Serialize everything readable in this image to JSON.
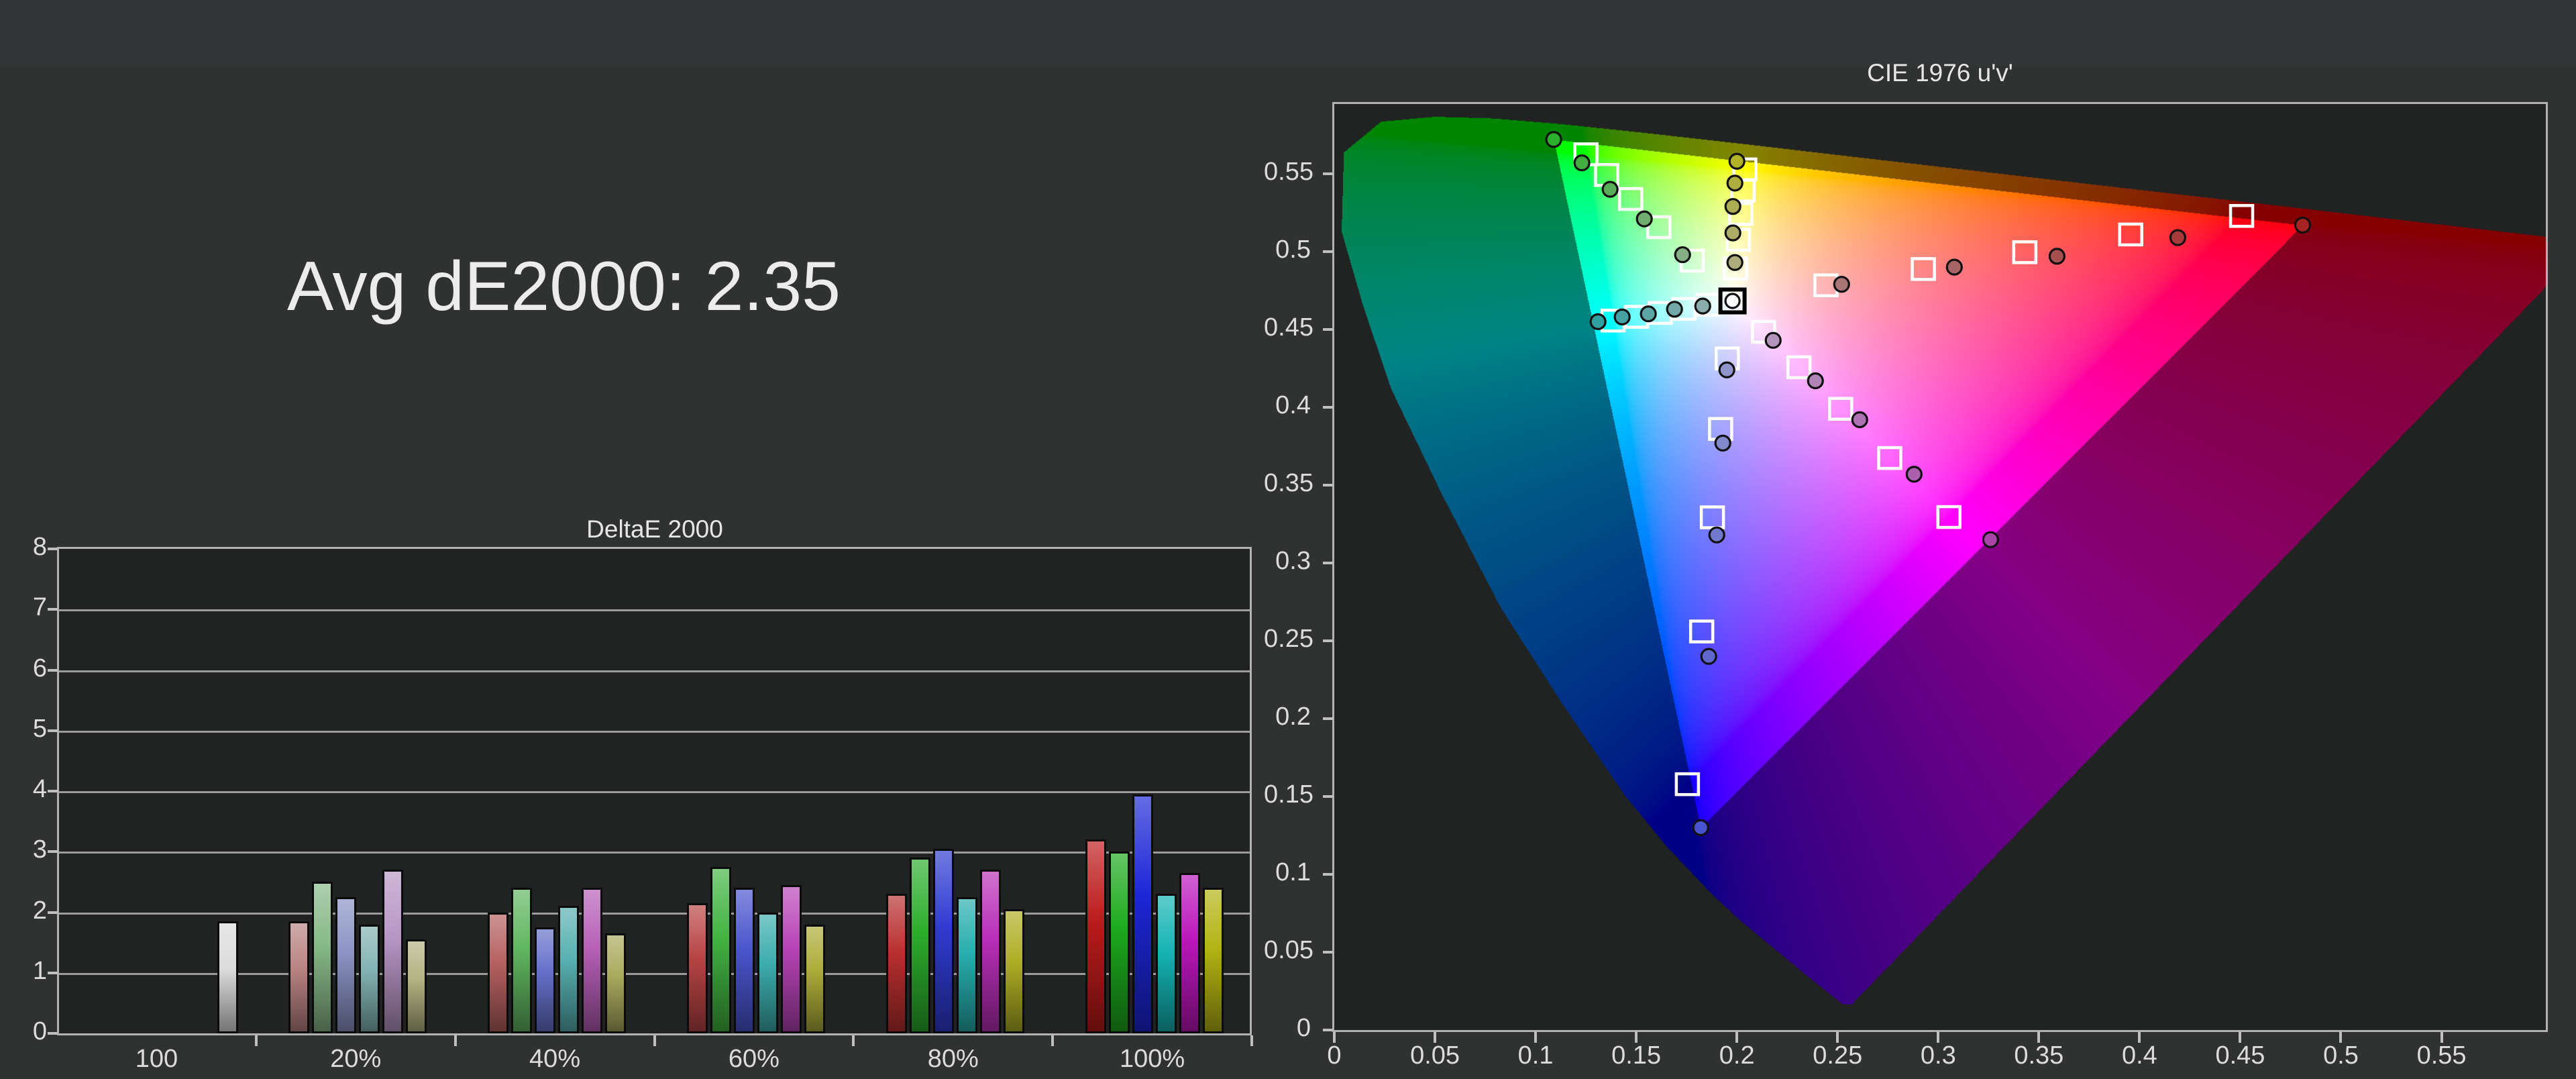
{
  "summary": {
    "text": "Avg dE2000: 2.35"
  },
  "colors": {
    "page_bg": "#303131",
    "plot_bg": "#212222",
    "grid": "#9b9b9b",
    "border": "#b2b2b2",
    "tick_text": "#dcdcdc",
    "title_text": "#e6e6e6",
    "bar_outline": "#0b0b0b",
    "target_square_stroke": "#ffffff",
    "white_square_stroke": "#000000",
    "measured_circle_stroke": "#111111",
    "outside_gamut_dim": 0.52
  },
  "chart_data": [
    {
      "type": "bar",
      "title": "DeltaE 2000",
      "ylabel": "",
      "xlabel": "",
      "ylim": [
        0,
        8
      ],
      "yticks": [
        "0",
        "1",
        "2",
        "3",
        "4",
        "5",
        "6",
        "7",
        "8"
      ],
      "grid": true,
      "categories": [
        "100",
        "20%",
        "40%",
        "60%",
        "80%",
        "100%"
      ],
      "groups": [
        {
          "label": "100",
          "bars": [
            {
              "series": "white",
              "value": 1.85,
              "color": "#dcdcdc"
            }
          ]
        },
        {
          "label": "20%",
          "bars": [
            {
              "series": "red",
              "value": 1.85,
              "color": "#b98383"
            },
            {
              "series": "green",
              "value": 2.5,
              "color": "#87b987"
            },
            {
              "series": "blue",
              "value": 2.25,
              "color": "#8a92c3"
            },
            {
              "series": "cyan",
              "value": 1.8,
              "color": "#83b3b3"
            },
            {
              "series": "magenta",
              "value": 2.7,
              "color": "#b795c4"
            },
            {
              "series": "yellow",
              "value": 1.55,
              "color": "#b3b383"
            }
          ]
        },
        {
          "label": "40%",
          "bars": [
            {
              "series": "red",
              "value": 2.0,
              "color": "#b66060"
            },
            {
              "series": "green",
              "value": 2.4,
              "color": "#60b660"
            },
            {
              "series": "blue",
              "value": 1.75,
              "color": "#6570c9"
            },
            {
              "series": "cyan",
              "value": 2.1,
              "color": "#57b0b0"
            },
            {
              "series": "magenta",
              "value": 2.4,
              "color": "#b65fb6"
            },
            {
              "series": "yellow",
              "value": 1.65,
              "color": "#aaaa5e"
            }
          ]
        },
        {
          "label": "60%",
          "bars": [
            {
              "series": "red",
              "value": 2.15,
              "color": "#b84444"
            },
            {
              "series": "green",
              "value": 2.75,
              "color": "#41b441"
            },
            {
              "series": "blue",
              "value": 2.4,
              "color": "#4a55cd"
            },
            {
              "series": "cyan",
              "value": 2.0,
              "color": "#3cadad"
            },
            {
              "series": "magenta",
              "value": 2.45,
              "color": "#b844b8"
            },
            {
              "series": "yellow",
              "value": 1.8,
              "color": "#acac38"
            }
          ]
        },
        {
          "label": "80%",
          "bars": [
            {
              "series": "red",
              "value": 2.3,
              "color": "#b92f2f"
            },
            {
              "series": "green",
              "value": 2.9,
              "color": "#2cae2c"
            },
            {
              "series": "blue",
              "value": 3.05,
              "color": "#303bd2"
            },
            {
              "series": "cyan",
              "value": 2.25,
              "color": "#27adad"
            },
            {
              "series": "magenta",
              "value": 2.7,
              "color": "#b92fb9"
            },
            {
              "series": "yellow",
              "value": 2.05,
              "color": "#aeae24"
            }
          ]
        },
        {
          "label": "100%",
          "bars": [
            {
              "series": "red",
              "value": 3.2,
              "color": "#bb1b1b"
            },
            {
              "series": "green",
              "value": 3.0,
              "color": "#1daa1d"
            },
            {
              "series": "blue",
              "value": 3.95,
              "color": "#1c26d6"
            },
            {
              "series": "cyan",
              "value": 2.3,
              "color": "#14b3b3"
            },
            {
              "series": "magenta",
              "value": 2.65,
              "color": "#bb16bb"
            },
            {
              "series": "yellow",
              "value": 2.4,
              "color": "#b3b314"
            }
          ]
        }
      ]
    },
    {
      "type": "scatter",
      "title": "CIE 1976 u'v'",
      "xlim": [
        0,
        0.6018
      ],
      "ylim": [
        0,
        0.5948
      ],
      "xticks": [
        "0",
        "0.05",
        "0.1",
        "0.15",
        "0.2",
        "0.25",
        "0.3",
        "0.35",
        "0.4",
        "0.45",
        "0.5",
        "0.55"
      ],
      "yticks": [
        "0",
        "0.05",
        "0.1",
        "0.15",
        "0.2",
        "0.25",
        "0.3",
        "0.35",
        "0.4",
        "0.45",
        "0.5",
        "0.55"
      ],
      "tick_step": 0.05,
      "white_point": {
        "target": [
          0.1978,
          0.4683
        ],
        "measured": [
          0.1978,
          0.4683
        ],
        "measured_color": "#ffffff"
      },
      "sweeps": [
        {
          "name": "red",
          "targets": [
            [
              0.2442,
              0.4783
            ],
            [
              0.2926,
              0.4888
            ],
            [
              0.343,
              0.4996
            ],
            [
              0.3956,
              0.511
            ],
            [
              0.4507,
              0.5229
            ]
          ],
          "measured": [
            [
              0.252,
              0.479
            ],
            [
              0.308,
              0.49
            ],
            [
              0.359,
              0.497
            ],
            [
              0.419,
              0.509
            ],
            [
              0.481,
              0.517
            ]
          ],
          "measured_colors": [
            "#a87676",
            "#a86464",
            "#a85050",
            "#a83a3a",
            "#a82424"
          ]
        },
        {
          "name": "green",
          "targets": [
            [
              0.1778,
              0.4942
            ],
            [
              0.1612,
              0.5157
            ],
            [
              0.1472,
              0.5338
            ],
            [
              0.1353,
              0.5492
            ],
            [
              0.125,
              0.5625
            ]
          ],
          "measured": [
            [
              0.173,
              0.498
            ],
            [
              0.154,
              0.521
            ],
            [
              0.137,
              0.54
            ],
            [
              0.123,
              0.557
            ],
            [
              0.109,
              0.572
            ]
          ],
          "measured_colors": [
            "#84ae84",
            "#6fae6f",
            "#58ae58",
            "#42ae42",
            "#2bb02b"
          ]
        },
        {
          "name": "blue",
          "targets": [
            [
              0.1952,
              0.4314
            ],
            [
              0.1919,
              0.3861
            ],
            [
              0.1878,
              0.3293
            ],
            [
              0.1825,
              0.256
            ],
            [
              0.1754,
              0.1579
            ]
          ],
          "measured": [
            [
              0.195,
              0.424
            ],
            [
              0.193,
              0.377
            ],
            [
              0.19,
              0.318
            ],
            [
              0.186,
              0.24
            ],
            [
              0.182,
              0.13
            ]
          ],
          "measured_colors": [
            "#9095cb",
            "#8288cb",
            "#7079cb",
            "#5d67cd",
            "#4853d2"
          ]
        },
        {
          "name": "cyan",
          "targets": [
            [
              0.1857,
              0.4658
            ],
            [
              0.1737,
              0.4632
            ],
            [
              0.1619,
              0.4606
            ],
            [
              0.1501,
              0.4581
            ],
            [
              0.1385,
              0.4557
            ]
          ],
          "measured": [
            [
              0.183,
              0.465
            ],
            [
              0.169,
              0.463
            ],
            [
              0.156,
              0.46
            ],
            [
              0.143,
              0.458
            ],
            [
              0.131,
              0.455
            ]
          ],
          "measured_colors": [
            "#8aacac",
            "#74a8a8",
            "#5da4a4",
            "#45a2a2",
            "#309f9f"
          ]
        },
        {
          "name": "magenta",
          "targets": [
            [
              0.2132,
              0.4485
            ],
            [
              0.2308,
              0.4257
            ],
            [
              0.2515,
              0.399
            ],
            [
              0.2759,
              0.3674
            ],
            [
              0.3053,
              0.3295
            ]
          ],
          "measured": [
            [
              0.218,
              0.443
            ],
            [
              0.239,
              0.417
            ],
            [
              0.261,
              0.392
            ],
            [
              0.288,
              0.357
            ],
            [
              0.326,
              0.315
            ]
          ],
          "measured_colors": [
            "#b493bd",
            "#b184b8",
            "#ae72b3",
            "#ab5fae",
            "#a945a9"
          ]
        },
        {
          "name": "yellow",
          "targets": [
            [
              0.1993,
              0.4891
            ],
            [
              0.2007,
              0.5076
            ],
            [
              0.2019,
              0.5242
            ],
            [
              0.203,
              0.5392
            ],
            [
              0.2039,
              0.5528
            ]
          ],
          "measured": [
            [
              0.199,
              0.493
            ],
            [
              0.198,
              0.512
            ],
            [
              0.198,
              0.529
            ],
            [
              0.199,
              0.544
            ],
            [
              0.2,
              0.558
            ]
          ],
          "measured_colors": [
            "#adad7c",
            "#adad68",
            "#adad54",
            "#aeae3e",
            "#b2b226"
          ]
        }
      ],
      "native_gamut_triangle": [
        [
          0.109,
          0.572
        ],
        [
          0.481,
          0.517
        ],
        [
          0.182,
          0.13
        ]
      ],
      "spectral_locus": [
        [
          0.2568,
          0.0166
        ],
        [
          0.2522,
          0.0169
        ],
        [
          0.2347,
          0.035
        ],
        [
          0.2161,
          0.0549
        ],
        [
          0.202,
          0.07
        ],
        [
          0.1877,
          0.0871
        ],
        [
          0.165,
          0.118
        ],
        [
          0.1441,
          0.151
        ],
        [
          0.113,
          0.21
        ],
        [
          0.0828,
          0.2708
        ],
        [
          0.053,
          0.345
        ],
        [
          0.0282,
          0.4117
        ],
        [
          0.014,
          0.466
        ],
        [
          0.0035,
          0.5131
        ],
        [
          0.0046,
          0.5639
        ],
        [
          0.0231,
          0.5837
        ],
        [
          0.0501,
          0.5868
        ],
        [
          0.0792,
          0.5857
        ],
        [
          0.1127,
          0.5821
        ],
        [
          0.1531,
          0.5766
        ],
        [
          0.2026,
          0.5694
        ],
        [
          0.2623,
          0.5604
        ],
        [
          0.3315,
          0.5501
        ],
        [
          0.4035,
          0.5393
        ],
        [
          0.4691,
          0.5296
        ],
        [
          0.5203,
          0.5219
        ],
        [
          0.5565,
          0.5165
        ],
        [
          0.6005,
          0.5099
        ],
        [
          0.6234,
          0.5065
        ]
      ]
    }
  ]
}
